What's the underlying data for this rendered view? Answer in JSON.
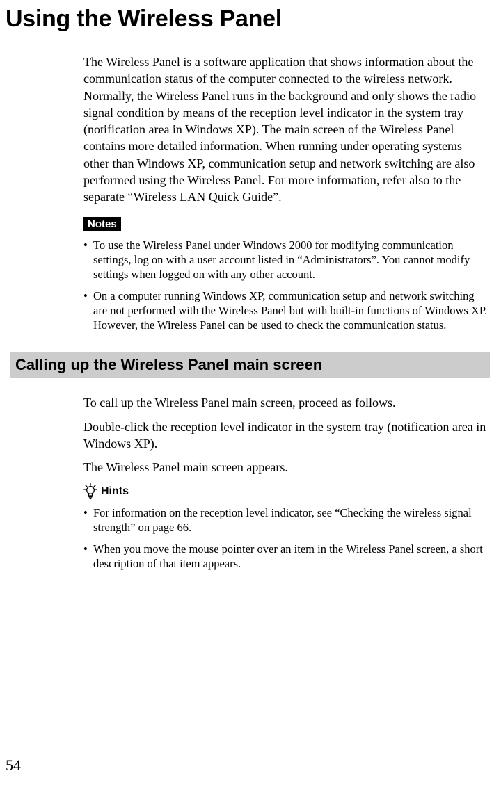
{
  "title": "Using the Wireless Panel",
  "intro": "The Wireless Panel is a software application that shows information about the communication status of the computer connected to the wireless network. Normally, the Wireless Panel runs in the background and only shows the radio signal condition by means of the reception level indicator in the system tray (notification area in Windows XP). The main screen of the Wireless Panel contains more detailed information. When running under operating systems other than Windows XP, communication setup and network switching are also performed using the Wireless Panel. For more information, refer also to the separate “Wireless LAN Quick Guide”.",
  "notes_label": "Notes",
  "notes": [
    "To use the Wireless Panel under Windows 2000 for modifying communication settings, log on with a user account listed in “Administrators”. You cannot modify settings when logged on with any other account.",
    "On a computer running Windows XP, communication setup and network switching are not performed with the Wireless Panel but with built-in functions of Windows XP. However, the Wireless Panel can be used to check the communication status."
  ],
  "section_heading": "Calling up the Wireless Panel main screen",
  "para1": "To call up the Wireless Panel main screen, proceed as follows.",
  "para2": "Double-click the reception level indicator in the system tray (notification area in Windows XP).",
  "para3": "The Wireless Panel main screen appears.",
  "hints_label": "Hints",
  "hints": [
    "For information on the reception level indicator, see “Checking the wireless signal strength” on page 66.",
    "When you move the mouse pointer over an item in the Wireless Panel screen, a short description of that item appears."
  ],
  "page_number": "54"
}
